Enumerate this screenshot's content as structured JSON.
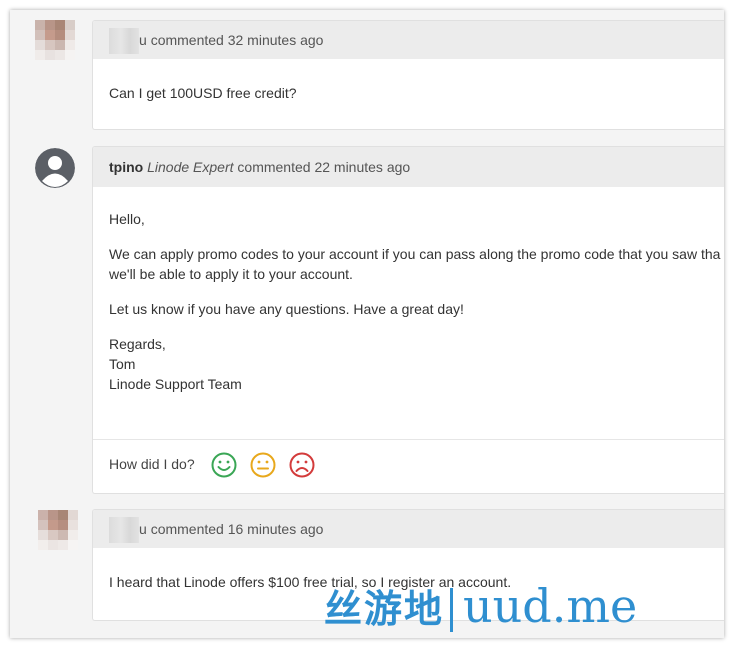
{
  "comments": [
    {
      "author_suffix": "u",
      "action": "commented 32 minutes ago",
      "body": [
        "Can I get 100USD free credit?"
      ]
    },
    {
      "author": "tpino",
      "role": "Linode Expert",
      "action": "commented 22 minutes ago",
      "body": [
        "Hello,",
        "We can apply promo codes to your account if you can pass along the promo code that you saw tha",
        "we'll be able to apply it to your account.",
        "Let us know if you have any questions. Have a great day!",
        "Regards,",
        "Tom",
        "Linode Support Team"
      ],
      "rating_label": "How did I do?",
      "rating_colors": {
        "happy": "#3aa655",
        "neutral": "#e8a81c",
        "sad": "#d33b3b"
      }
    },
    {
      "author_suffix": "u",
      "action": "commented 16 minutes ago",
      "body": [
        "I heard that Linode offers $100 free trial, so I register an account."
      ]
    }
  ],
  "watermark": {
    "cjk": "丝游地",
    "latin": "uud.me"
  },
  "colors": {
    "header_bg": "#ececec",
    "page_bg": "#f4f4f4",
    "watermark": "#2f8fd0"
  }
}
